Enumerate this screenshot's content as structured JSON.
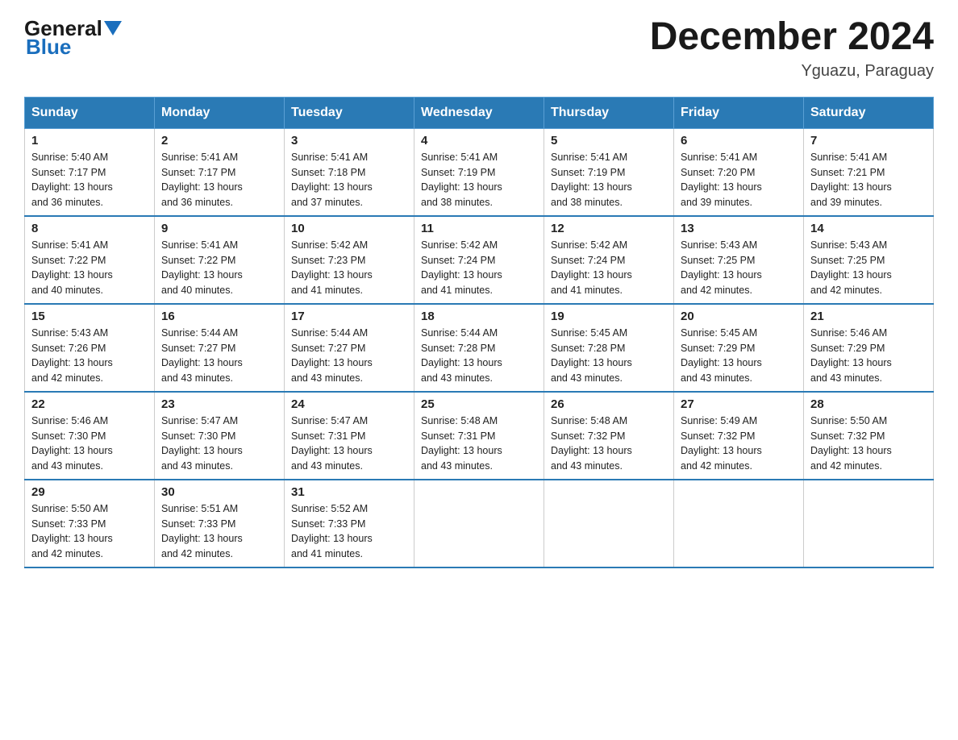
{
  "logo": {
    "general": "General",
    "blue": "Blue"
  },
  "title": "December 2024",
  "location": "Yguazu, Paraguay",
  "headers": [
    "Sunday",
    "Monday",
    "Tuesday",
    "Wednesday",
    "Thursday",
    "Friday",
    "Saturday"
  ],
  "weeks": [
    [
      {
        "day": "1",
        "sunrise": "5:40 AM",
        "sunset": "7:17 PM",
        "daylight": "13 hours and 36 minutes."
      },
      {
        "day": "2",
        "sunrise": "5:41 AM",
        "sunset": "7:17 PM",
        "daylight": "13 hours and 36 minutes."
      },
      {
        "day": "3",
        "sunrise": "5:41 AM",
        "sunset": "7:18 PM",
        "daylight": "13 hours and 37 minutes."
      },
      {
        "day": "4",
        "sunrise": "5:41 AM",
        "sunset": "7:19 PM",
        "daylight": "13 hours and 38 minutes."
      },
      {
        "day": "5",
        "sunrise": "5:41 AM",
        "sunset": "7:19 PM",
        "daylight": "13 hours and 38 minutes."
      },
      {
        "day": "6",
        "sunrise": "5:41 AM",
        "sunset": "7:20 PM",
        "daylight": "13 hours and 39 minutes."
      },
      {
        "day": "7",
        "sunrise": "5:41 AM",
        "sunset": "7:21 PM",
        "daylight": "13 hours and 39 minutes."
      }
    ],
    [
      {
        "day": "8",
        "sunrise": "5:41 AM",
        "sunset": "7:22 PM",
        "daylight": "13 hours and 40 minutes."
      },
      {
        "day": "9",
        "sunrise": "5:41 AM",
        "sunset": "7:22 PM",
        "daylight": "13 hours and 40 minutes."
      },
      {
        "day": "10",
        "sunrise": "5:42 AM",
        "sunset": "7:23 PM",
        "daylight": "13 hours and 41 minutes."
      },
      {
        "day": "11",
        "sunrise": "5:42 AM",
        "sunset": "7:24 PM",
        "daylight": "13 hours and 41 minutes."
      },
      {
        "day": "12",
        "sunrise": "5:42 AM",
        "sunset": "7:24 PM",
        "daylight": "13 hours and 41 minutes."
      },
      {
        "day": "13",
        "sunrise": "5:43 AM",
        "sunset": "7:25 PM",
        "daylight": "13 hours and 42 minutes."
      },
      {
        "day": "14",
        "sunrise": "5:43 AM",
        "sunset": "7:25 PM",
        "daylight": "13 hours and 42 minutes."
      }
    ],
    [
      {
        "day": "15",
        "sunrise": "5:43 AM",
        "sunset": "7:26 PM",
        "daylight": "13 hours and 42 minutes."
      },
      {
        "day": "16",
        "sunrise": "5:44 AM",
        "sunset": "7:27 PM",
        "daylight": "13 hours and 43 minutes."
      },
      {
        "day": "17",
        "sunrise": "5:44 AM",
        "sunset": "7:27 PM",
        "daylight": "13 hours and 43 minutes."
      },
      {
        "day": "18",
        "sunrise": "5:44 AM",
        "sunset": "7:28 PM",
        "daylight": "13 hours and 43 minutes."
      },
      {
        "day": "19",
        "sunrise": "5:45 AM",
        "sunset": "7:28 PM",
        "daylight": "13 hours and 43 minutes."
      },
      {
        "day": "20",
        "sunrise": "5:45 AM",
        "sunset": "7:29 PM",
        "daylight": "13 hours and 43 minutes."
      },
      {
        "day": "21",
        "sunrise": "5:46 AM",
        "sunset": "7:29 PM",
        "daylight": "13 hours and 43 minutes."
      }
    ],
    [
      {
        "day": "22",
        "sunrise": "5:46 AM",
        "sunset": "7:30 PM",
        "daylight": "13 hours and 43 minutes."
      },
      {
        "day": "23",
        "sunrise": "5:47 AM",
        "sunset": "7:30 PM",
        "daylight": "13 hours and 43 minutes."
      },
      {
        "day": "24",
        "sunrise": "5:47 AM",
        "sunset": "7:31 PM",
        "daylight": "13 hours and 43 minutes."
      },
      {
        "day": "25",
        "sunrise": "5:48 AM",
        "sunset": "7:31 PM",
        "daylight": "13 hours and 43 minutes."
      },
      {
        "day": "26",
        "sunrise": "5:48 AM",
        "sunset": "7:32 PM",
        "daylight": "13 hours and 43 minutes."
      },
      {
        "day": "27",
        "sunrise": "5:49 AM",
        "sunset": "7:32 PM",
        "daylight": "13 hours and 42 minutes."
      },
      {
        "day": "28",
        "sunrise": "5:50 AM",
        "sunset": "7:32 PM",
        "daylight": "13 hours and 42 minutes."
      }
    ],
    [
      {
        "day": "29",
        "sunrise": "5:50 AM",
        "sunset": "7:33 PM",
        "daylight": "13 hours and 42 minutes."
      },
      {
        "day": "30",
        "sunrise": "5:51 AM",
        "sunset": "7:33 PM",
        "daylight": "13 hours and 42 minutes."
      },
      {
        "day": "31",
        "sunrise": "5:52 AM",
        "sunset": "7:33 PM",
        "daylight": "13 hours and 41 minutes."
      },
      null,
      null,
      null,
      null
    ]
  ],
  "labels": {
    "sunrise": "Sunrise:",
    "sunset": "Sunset:",
    "daylight": "Daylight:"
  },
  "accent_color": "#2a7ab5"
}
